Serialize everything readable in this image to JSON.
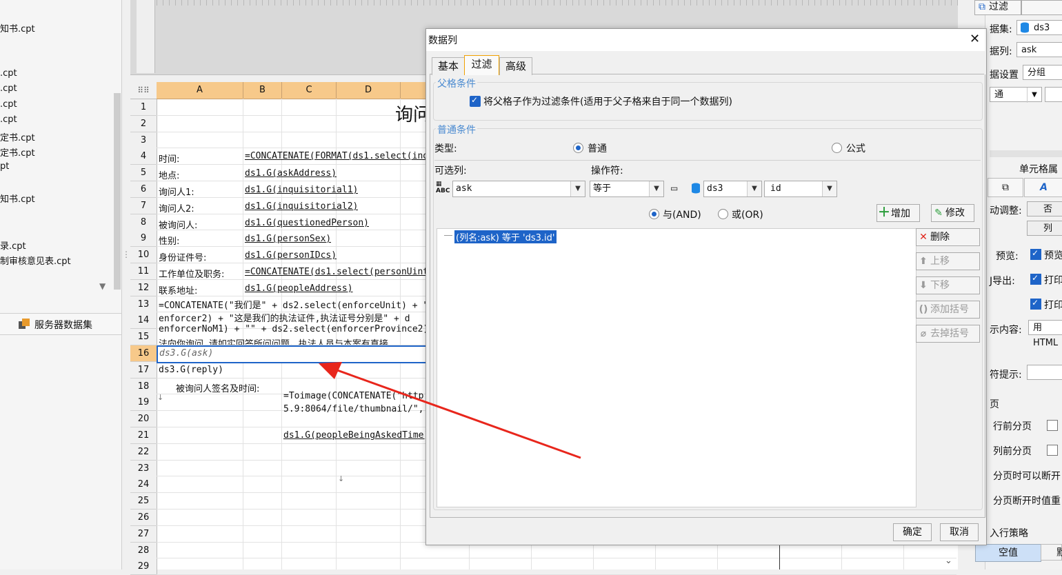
{
  "left_panel": {
    "files": [
      "知书.cpt",
      ".cpt",
      ".cpt",
      ".cpt",
      ".cpt",
      "定书.cpt",
      "定书.cpt",
      "pt",
      "知书.cpt",
      "录.cpt",
      "制审核意见表.cpt"
    ],
    "server_dataset_label": "服务器数据集"
  },
  "sheet": {
    "columns": [
      "A",
      "B",
      "C",
      "D"
    ],
    "rows": [
      "1",
      "2",
      "3",
      "4",
      "5",
      "6",
      "7",
      "8",
      "9",
      "10",
      "11",
      "12",
      "13",
      "14",
      "15",
      "16",
      "17",
      "18",
      "19",
      "20",
      "21",
      "22",
      "23",
      "24",
      "25",
      "26",
      "27",
      "28",
      "29"
    ],
    "selected_row": "16",
    "title_partial": "询问",
    "cells": {
      "r4a": "时间:",
      "r4b": "=CONCATENATE(FORMAT(ds1.select(inqu",
      "r5a": "地点:",
      "r5b": "ds1.G(askAddress)",
      "r6a": "询问人1:",
      "r6b": "ds1.G(inquisitorial1)",
      "r7a": "询问人2:",
      "r7b": "ds1.G(inquisitorial2)",
      "r8a": "被询问人:",
      "r8b": "ds1.G(questionedPerson)",
      "r9a": "性别:",
      "r9b": "ds1.G(personSex)",
      "r10a": "身份证件号:",
      "r10b": "ds1.G(personIDcs)",
      "r11a": "工作单位及职务:",
      "r11b": "=CONCATENATE(ds1.select(personUint)",
      "r12a": "联系地址:",
      "r12b": "ds1.G(peopleAddress)",
      "r13": "=CONCATENATE(\"我们是\" + ds2.select(enforceUnit) + \"的",
      "r14": "enforcer2) + \"这是我们的执法证件,执法证号分别是\" + d",
      "r15": "enforcerNoM1) + \"\" + ds2.select(enforcerProvince2) +",
      "r15b": "法向你询问,请如实回答所问问题。执法人员与本案有直接",
      "r16": "ds3.G(ask)",
      "r17": "ds3.G(reply)",
      "r18": "被询问人签名及时间:",
      "r19": "=Toimage(CONCATENATE(\"http:/",
      "r19b": "5.9:8064/file/thumbnail/\", d",
      "r21": "ds1.G(peopleBeingAskedTime)"
    }
  },
  "right_panel": {
    "filter_btn": "过滤",
    "dataset_label": "据集:",
    "dataset_value": "ds3",
    "column_label": "据列:",
    "column_value": "ask",
    "setting_label": "据设置",
    "setting_value": "分组",
    "type_value": "通",
    "cell_attr": "单元格属",
    "adjust_label": "动调整:",
    "adjust_v1": "否",
    "adjust_v2": "列",
    "preview_label": "预览:",
    "preview_value": "预览",
    "export_label": "J导出:",
    "print1": "打印",
    "print2": "打印",
    "content_label": "示内容:",
    "content_value": "用HTML",
    "hint_label": "符提示:",
    "page_label": "页",
    "row_break": "行前分页",
    "col_break": "列前分页",
    "break_allow": "分页时可以断开",
    "break_repeat": "分页断开时值重",
    "strategy": "入行策略",
    "empty_value": "空值",
    "other_value": "默"
  },
  "dialog": {
    "title": "数据列",
    "tabs": [
      "基本",
      "过滤",
      "高级"
    ],
    "active_tab": "过滤",
    "parent_group": "父格条件",
    "parent_checkbox": "将父格子作为过滤条件(适用于父子格来自于同一个数据列)",
    "normal_group": "普通条件",
    "type_label": "类型:",
    "type_normal": "普通",
    "type_formula": "公式",
    "column_label": "可选列:",
    "operator_label": "操作符:",
    "column_value": "ask",
    "operator_value": "等于",
    "ds_value": "ds3",
    "field_value": "id",
    "and_label": "与(AND)",
    "or_label": "或(OR)",
    "add_btn": "增加",
    "modify_btn": "修改",
    "delete_btn": "删除",
    "up_btn": "上移",
    "down_btn": "下移",
    "add_paren_btn": "添加括号",
    "remove_paren_btn": "去掉括号",
    "condition_item": "(列名:ask) 等于 'ds3.id'",
    "ok_btn": "确定",
    "cancel_btn": "取消"
  },
  "colors": {
    "accent": "#1e64c8",
    "column_header": "#f7c98a",
    "annotation_arrow": "#e8261c"
  }
}
